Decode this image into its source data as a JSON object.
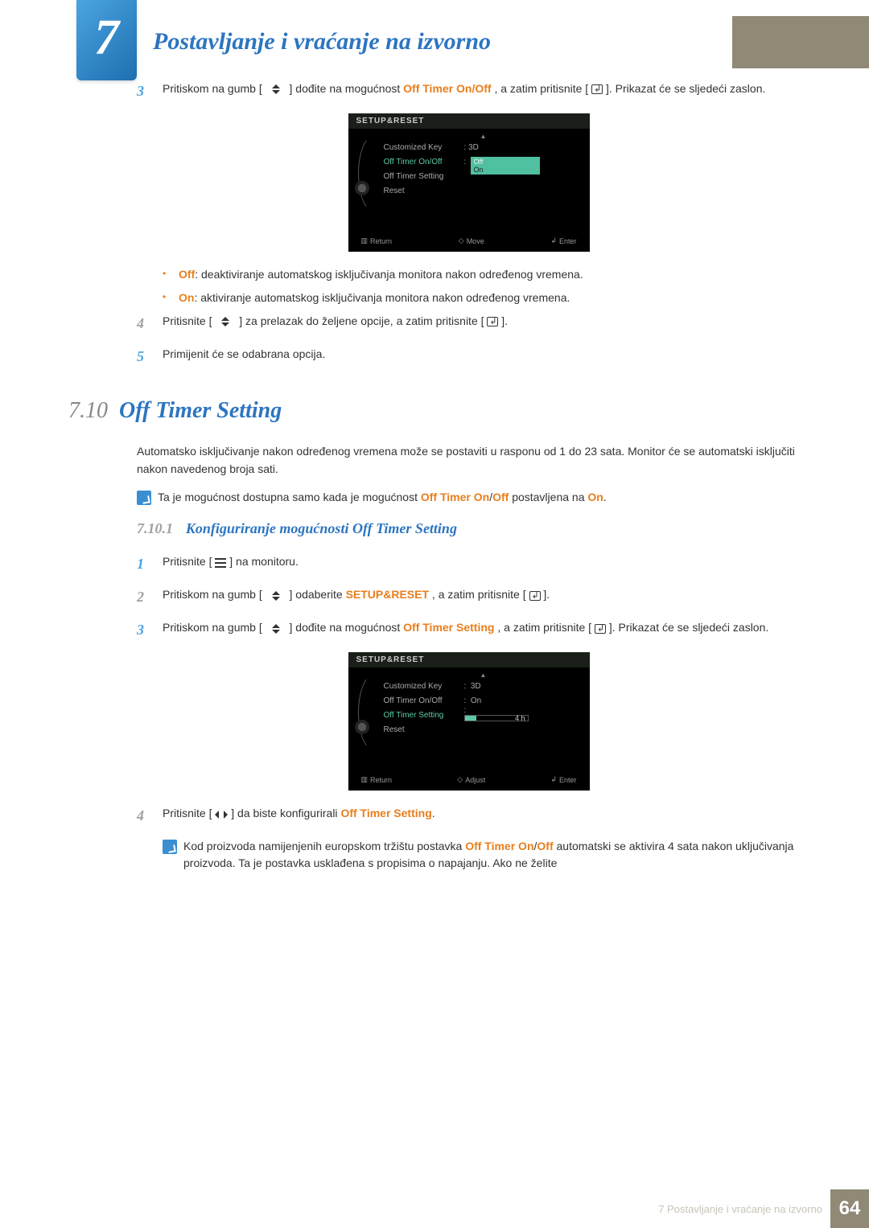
{
  "chapter": {
    "number": "7",
    "title": "Postavljanje i vraćanje na izvorno"
  },
  "step3": {
    "num": "3",
    "text_before": "Pritiskom na gumb [",
    "text_mid1": "] dođite na mogućnost ",
    "highlight1": "Off Timer On/Off",
    "text_mid2": ", a zatim pritisnite [",
    "text_after": "]. Prikazat će se sljedeći zaslon."
  },
  "osd1": {
    "title": "SETUP&RESET",
    "rows": {
      "customized_key": {
        "label": "Customized Key",
        "value": "3D"
      },
      "off_timer_onoff": {
        "label": "Off Timer On/Off",
        "options": {
          "opt1": "Off",
          "opt2": "On"
        }
      },
      "off_timer_setting": {
        "label": "Off Timer Setting"
      },
      "reset": {
        "label": "Reset"
      }
    },
    "footer": {
      "return": "Return",
      "move": "Move",
      "enter": "Enter"
    }
  },
  "bullets": {
    "off_label": "Off",
    "off_text": ": deaktiviranje automatskog isključivanja monitora nakon određenog vremena.",
    "on_label": "On",
    "on_text": ": aktiviranje automatskog isključivanja monitora nakon određenog vremena."
  },
  "step4": {
    "num": "4",
    "text_before": "Pritisnite [",
    "text_mid": "] za prelazak do željene opcije, a zatim pritisnite [",
    "text_after": "]."
  },
  "step5": {
    "num": "5",
    "text": "Primijenit će se odabrana opcija."
  },
  "section": {
    "number": "7.10",
    "title": "Off Timer Setting"
  },
  "section_para1": "Automatsko isključivanje nakon određenog vremena može se postaviti u rasponu od 1 do 23 sata. Monitor će se automatski isključiti nakon navedenog broja sati.",
  "note1": {
    "before": "Ta je mogućnost dostupna samo kada je mogućnost ",
    "h1": "Off Timer On",
    "slash": "/",
    "h2": "Off",
    "mid": " postavljena na ",
    "h3": "On",
    "after": "."
  },
  "subsection": {
    "number": "7.10.1",
    "title": "Konfiguriranje mogućnosti Off Timer Setting"
  },
  "s1": {
    "num": "1",
    "before": "Pritisnite [ ",
    "after": " ] na monitoru."
  },
  "s2": {
    "num": "2",
    "before": "Pritiskom na gumb [",
    "mid1": "] odaberite ",
    "h1": "SETUP&RESET",
    "mid2": ", a zatim pritisnite [",
    "after": "]."
  },
  "s3": {
    "num": "3",
    "before": "Pritiskom na gumb [",
    "mid1": "] dođite na mogućnost ",
    "h1": "Off Timer Setting",
    "mid2": ", a zatim pritisnite [",
    "after": "]. Prikazat će se sljedeći zaslon."
  },
  "osd2": {
    "title": "SETUP&RESET",
    "rows": {
      "customized_key": {
        "label": "Customized Key",
        "value": "3D"
      },
      "off_timer_onoff": {
        "label": "Off Timer On/Off",
        "value": "On"
      },
      "off_timer_setting": {
        "label": "Off Timer Setting",
        "value": "4 h"
      },
      "reset": {
        "label": "Reset"
      }
    },
    "footer": {
      "return": "Return",
      "adjust": "Adjust",
      "enter": "Enter"
    }
  },
  "s4": {
    "num": "4",
    "before": "Pritisnite [",
    "mid": "] da biste konfigurirali ",
    "h1": "Off Timer Setting",
    "after": "."
  },
  "note2": {
    "before": "Kod proizvoda namijenjenih europskom tržištu postavka ",
    "h1": "Off Timer On",
    "slash": "/",
    "h2": "Off",
    "after": " automatski se aktivira 4 sata nakon uključivanja proizvoda. Ta je postavka usklađena s propisima o napajanju. Ako ne želite"
  },
  "footer": {
    "text": "7  Postavljanje i vraćanje na izvorno",
    "page": "64"
  }
}
